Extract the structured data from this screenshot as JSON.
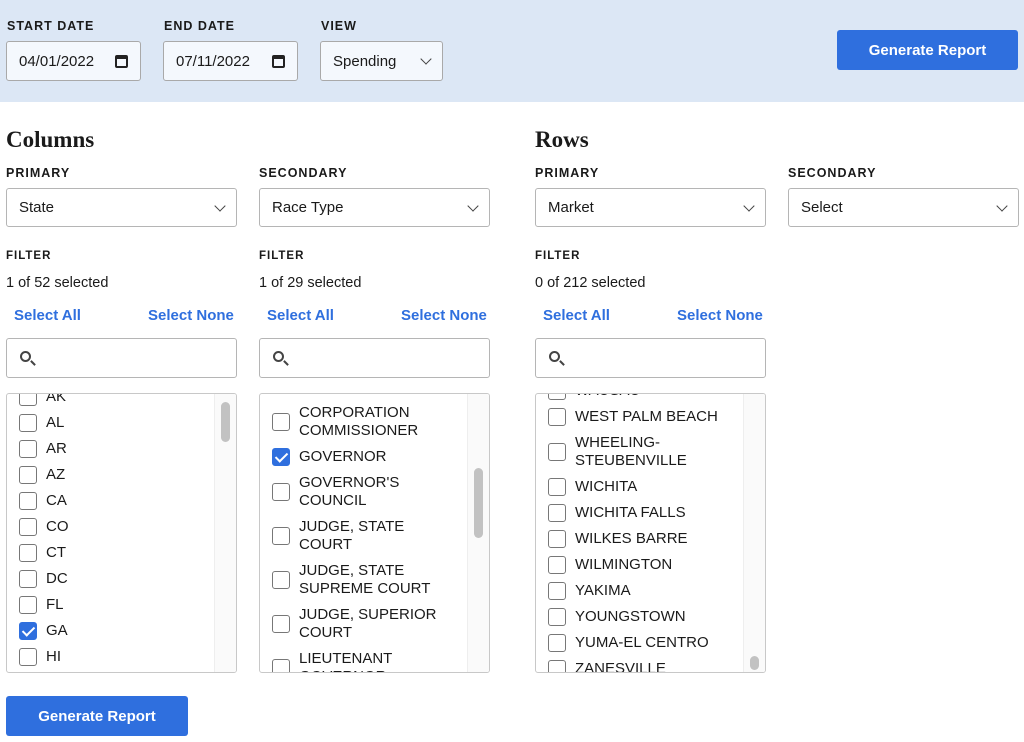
{
  "header": {
    "start_label": "START DATE",
    "start_value": "04/01/2022",
    "end_label": "END DATE",
    "end_value": "07/11/2022",
    "view_label": "VIEW",
    "view_value": "Spending",
    "generate": "Generate Report"
  },
  "columns": {
    "title": "Columns",
    "primary": {
      "label": "PRIMARY",
      "value": "State",
      "filter_label": "FILTER",
      "count": "1 of 52 selected",
      "select_all": "Select All",
      "select_none": "Select None",
      "items": [
        {
          "t": "AK",
          "c": false
        },
        {
          "t": "AL",
          "c": false
        },
        {
          "t": "AR",
          "c": false
        },
        {
          "t": "AZ",
          "c": false
        },
        {
          "t": "CA",
          "c": false
        },
        {
          "t": "CO",
          "c": false
        },
        {
          "t": "CT",
          "c": false
        },
        {
          "t": "DC",
          "c": false
        },
        {
          "t": "FL",
          "c": false
        },
        {
          "t": "GA",
          "c": true
        },
        {
          "t": "HI",
          "c": false
        }
      ]
    },
    "secondary": {
      "label": "SECONDARY",
      "value": "Race Type",
      "filter_label": "FILTER",
      "count": "1 of 29 selected",
      "select_all": "Select All",
      "select_none": "Select None",
      "items": [
        {
          "t": "Corporation Commissioner",
          "c": false
        },
        {
          "t": "Governor",
          "c": true
        },
        {
          "t": "Governor's Council",
          "c": false
        },
        {
          "t": "Judge, State Court",
          "c": false
        },
        {
          "t": "Judge, State Supreme Court",
          "c": false
        },
        {
          "t": "Judge, Superior Court",
          "c": false
        },
        {
          "t": "Lieutenant Governor",
          "c": false
        }
      ]
    }
  },
  "rows": {
    "title": "Rows",
    "primary": {
      "label": "PRIMARY",
      "value": "Market",
      "filter_label": "FILTER",
      "count": "0 of 212 selected",
      "select_all": "Select All",
      "select_none": "Select None",
      "items": [
        {
          "t": "Wausau",
          "c": false
        },
        {
          "t": "West Palm Beach",
          "c": false
        },
        {
          "t": "Wheeling-Steubenville",
          "c": false
        },
        {
          "t": "Wichita",
          "c": false
        },
        {
          "t": "Wichita Falls",
          "c": false
        },
        {
          "t": "Wilkes Barre",
          "c": false
        },
        {
          "t": "Wilmington",
          "c": false
        },
        {
          "t": "Yakima",
          "c": false
        },
        {
          "t": "Youngstown",
          "c": false
        },
        {
          "t": "Yuma-El Centro",
          "c": false
        },
        {
          "t": "Zanesville",
          "c": false
        }
      ]
    },
    "secondary": {
      "label": "SECONDARY",
      "value": "Select"
    }
  },
  "footer": {
    "generate": "Generate Report"
  },
  "colors": {
    "accent": "#2f6fde",
    "header_bg": "#dce7f5"
  }
}
